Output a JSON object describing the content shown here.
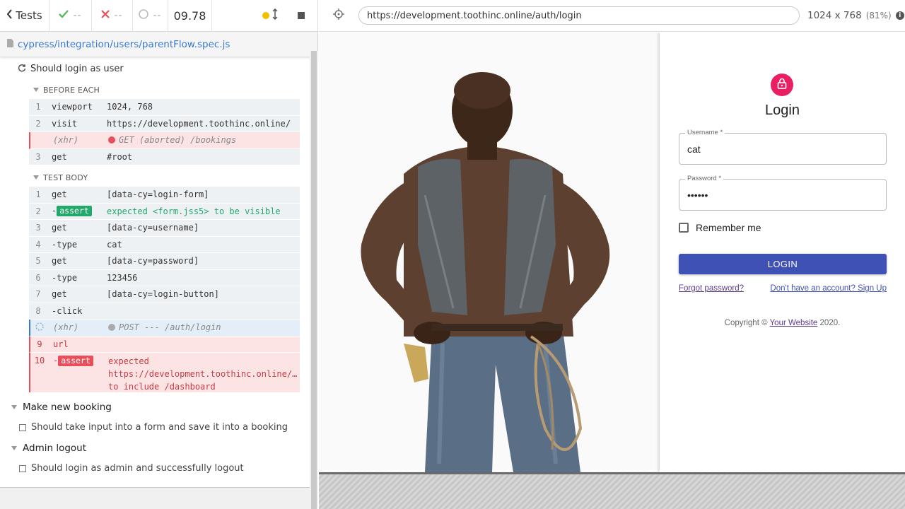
{
  "stats": {
    "tests_label": "Tests",
    "passed": "--",
    "failed": "--",
    "pending": "--",
    "duration": "09.78"
  },
  "spec": {
    "path": "cypress/integration/users/parentFlow.spec.js"
  },
  "current_test": {
    "title": "Should login as user",
    "before_each_label": "BEFORE EACH",
    "before_each": [
      {
        "num": "1",
        "name": "viewport",
        "msg": "1024, 768"
      },
      {
        "num": "2",
        "name": "visit",
        "msg": "https://development.toothinc.online/"
      },
      {
        "num": "",
        "name": "(xhr)",
        "msg": "GET (aborted) /bookings"
      },
      {
        "num": "3",
        "name": "get",
        "msg": "#root"
      }
    ],
    "test_body_label": "TEST BODY",
    "test_body": [
      {
        "num": "1",
        "name": "get",
        "msg": "[data-cy=login-form]"
      },
      {
        "num": "2",
        "name": "-",
        "badge": "assert",
        "msg": "expected <form.jss5> to be visible"
      },
      {
        "num": "3",
        "name": "get",
        "msg": "[data-cy=username]"
      },
      {
        "num": "4",
        "name": "-type",
        "msg": "cat"
      },
      {
        "num": "5",
        "name": "get",
        "msg": "[data-cy=password]"
      },
      {
        "num": "6",
        "name": "-type",
        "msg": "123456"
      },
      {
        "num": "7",
        "name": "get",
        "msg": "[data-cy=login-button]"
      },
      {
        "num": "8",
        "name": "-click",
        "msg": ""
      },
      {
        "num": "",
        "name": "(xhr)",
        "msg": "POST --- /auth/login"
      },
      {
        "num": "9",
        "name": "url",
        "msg": ""
      },
      {
        "num": "10",
        "name": "-",
        "badge": "assert",
        "msg_line1": "expected",
        "msg_line2": "https://development.toothinc.online/auth/login",
        "msg_line3": "to include /dashboard"
      }
    ]
  },
  "suites": [
    {
      "title": "Make new booking",
      "test": "Should take input into a form and save it into a booking"
    },
    {
      "title": "Admin logout",
      "test": "Should login as admin and successfully logout"
    }
  ],
  "aut": {
    "url": "https://development.toothinc.online/auth/login",
    "viewport": "1024 x 768",
    "scale": "(81%)"
  },
  "login": {
    "heading": "Login",
    "username_label": "Username *",
    "username_value": "cat",
    "password_label": "Password *",
    "password_value": "••••••",
    "remember_label": "Remember me",
    "button_label": "LOGIN",
    "forgot_link": "Forgot password?",
    "signup_link": "Don't have an account? Sign Up",
    "copyright_prefix": "Copyright ©",
    "copyright_link": "Your Website",
    "copyright_suffix": "2020."
  },
  "colors": {
    "accent_blue": "#3f51b5",
    "lock_pink": "#e91e63",
    "fail_red": "#e94f5a",
    "pass_green": "#21a86a"
  }
}
